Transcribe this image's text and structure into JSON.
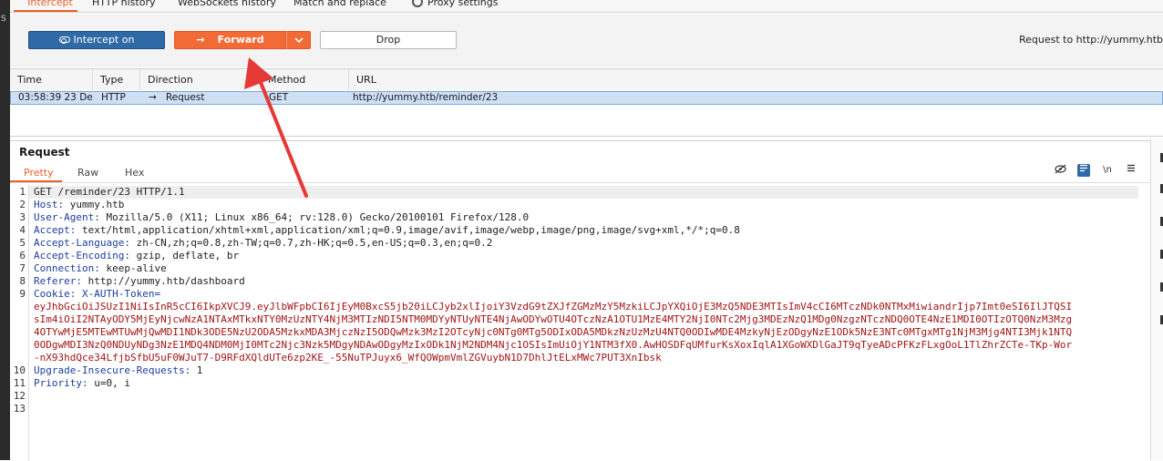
{
  "tabs": {
    "intercept": "Intercept",
    "http_history": "HTTP history",
    "websockets_history": "WebSockets history",
    "match_replace": "Match and replace",
    "proxy_settings": "Proxy settings"
  },
  "toolbar": {
    "intercept_label": "Intercept on",
    "forward_label": "Forward",
    "drop_label": "Drop",
    "request_to": "Request to http://yummy.htb"
  },
  "history": {
    "columns": [
      "Time",
      "Type",
      "Direction",
      "Method",
      "URL"
    ],
    "row": {
      "time": "03:58:39 23 De...",
      "type": "HTTP",
      "direction": "Request",
      "method": "GET",
      "url": "http://yummy.htb/reminder/23"
    }
  },
  "request_panel": {
    "title": "Request",
    "tabs": [
      "Pretty",
      "Raw",
      "Hex"
    ],
    "newline_label": "\\n",
    "lines": [
      {
        "n": "1",
        "k": "GET /reminder/23 HTTP/1.1",
        "v": ""
      },
      {
        "n": "2",
        "k": "Host:",
        "v": " yummy.htb"
      },
      {
        "n": "3",
        "k": "User-Agent:",
        "v": " Mozilla/5.0 (X11; Linux x86_64; rv:128.0) Gecko/20100101 Firefox/128.0"
      },
      {
        "n": "4",
        "k": "Accept:",
        "v": " text/html,application/xhtml+xml,application/xml;q=0.9,image/avif,image/webp,image/png,image/svg+xml,*/*;q=0.8"
      },
      {
        "n": "5",
        "k": "Accept-Language:",
        "v": " zh-CN,zh;q=0.8,zh-TW;q=0.7,zh-HK;q=0.5,en-US;q=0.3,en;q=0.2"
      },
      {
        "n": "6",
        "k": "Accept-Encoding:",
        "v": " gzip, deflate, br"
      },
      {
        "n": "7",
        "k": "Connection:",
        "v": " keep-alive"
      },
      {
        "n": "8",
        "k": "Referer:",
        "v": " http://yummy.htb/dashboard"
      },
      {
        "n": "9",
        "k": "Cookie:",
        "v": " X-AUTH-Token="
      }
    ],
    "token_lines": [
      "eyJhbGciOiJSUzI1NiIsInR5cCI6IkpXVCJ9.eyJlbWFpbCI6IjEyM0BxcS5jb20iLCJyb2xlIjoiY3VzdG9tZXJfZGMzMzY5MzkiLCJpYXQiOjE3MzQ5NDE3MTIsImV4cCI6MTczNDk0NTMxMiwiandrIjp7Imt0eSI6IlJTQSI",
      "sIm4iOiI2NTAyODY5MjEyNjcwNzA1NTAxMTkxNTY0MzUzNTY4NjM3MTIzNDI5NTM0MDYyNTUyNTE4NjAwODYwOTU4OTczNzA1OTU1MzE4MTY2NjI0NTc2Mjg3MDEzNzQ1MDg0NzgzNTczNDQ0OTE4NzE1MDI0OTIzOTQ0NzM3Mzg",
      "4OTYwMjE5MTEwMTUwMjQwMDI1NDk3ODE5NzU2ODA5MzkxMDA3MjczNzI5ODQwMzk3MzI2OTcyNjc0NTg0MTg5ODIxODA5MDkzNzUzMzU4NTQ0ODIwMDE4MzkyNjEzODgyNzE1ODk5NzE3NTc0MTgxMTg1NjM3Mjg4NTI3Mjk1NTQ",
      "0ODgwMDI3NzQ0NDUyNDg3NzE1MDQ4NDM0MjI0MTc2Njc3Nzk5MDgyNDAwODgyMzIxODk1NjM2NDM4Njc1OSIsImUiOjY1NTM3fX0.AwHOSDFqUMfurKsXoxIqlA1XGoWXDlGaJT9qTyeADcPFKzFLxgOoL1TlZhrZCTe-TKp-Wor",
      "-nX93hdQce34LfjbSfbU5uF0WJuT7-D9RFdXQldUTe6zp2KE_-55NuTPJuyx6_WfQOWpmVmlZGVuybN1D7DhlJtELxMWc7PUT3XnIbsk"
    ],
    "tail_lines": [
      {
        "n": "10",
        "k": "Upgrade-Insecure-Requests:",
        "v": " 1"
      },
      {
        "n": "11",
        "k": "Priority:",
        "v": " u=0, i"
      },
      {
        "n": "12",
        "k": "",
        "v": ""
      },
      {
        "n": "13",
        "k": "",
        "v": ""
      }
    ]
  },
  "colors": {
    "accent": "#e8612c",
    "forward_button": "#f26a35",
    "intercept_button": "#2f6aa6",
    "header_name": "#1d3d9c",
    "cookie_value": "#a11616",
    "annotation_arrow": "#e53935"
  }
}
